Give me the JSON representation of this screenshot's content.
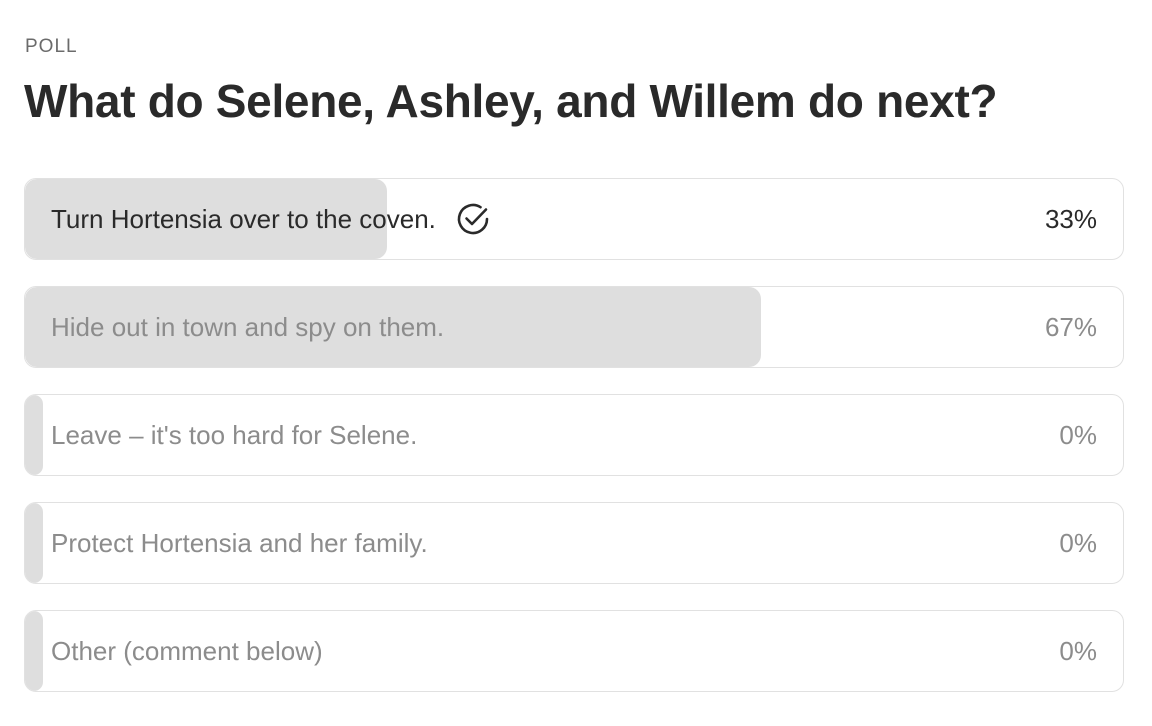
{
  "poll": {
    "label": "POLL",
    "question": "What do Selene, Ashley, and Willem do next?",
    "options": [
      {
        "text": "Turn Hortensia over to the coven.",
        "percent_label": "33%",
        "share": 0.33,
        "voted": true
      },
      {
        "text": "Hide out in town and spy on them.",
        "percent_label": "67%",
        "share": 0.67,
        "voted": false
      },
      {
        "text": "Leave – it's too hard for Selene.",
        "percent_label": "0%",
        "share": 0,
        "voted": false
      },
      {
        "text": "Protect Hortensia and her family.",
        "percent_label": "0%",
        "share": 0,
        "voted": false
      },
      {
        "text": "Other (comment below)",
        "percent_label": "0%",
        "share": 0,
        "voted": false
      }
    ]
  },
  "colors": {
    "fill": "#dedede",
    "border": "#e1e1e1",
    "text_primary": "#2a2a2a",
    "text_muted": "#8c8c8c"
  },
  "icons": {
    "voted_marker": "check-circle-icon"
  }
}
